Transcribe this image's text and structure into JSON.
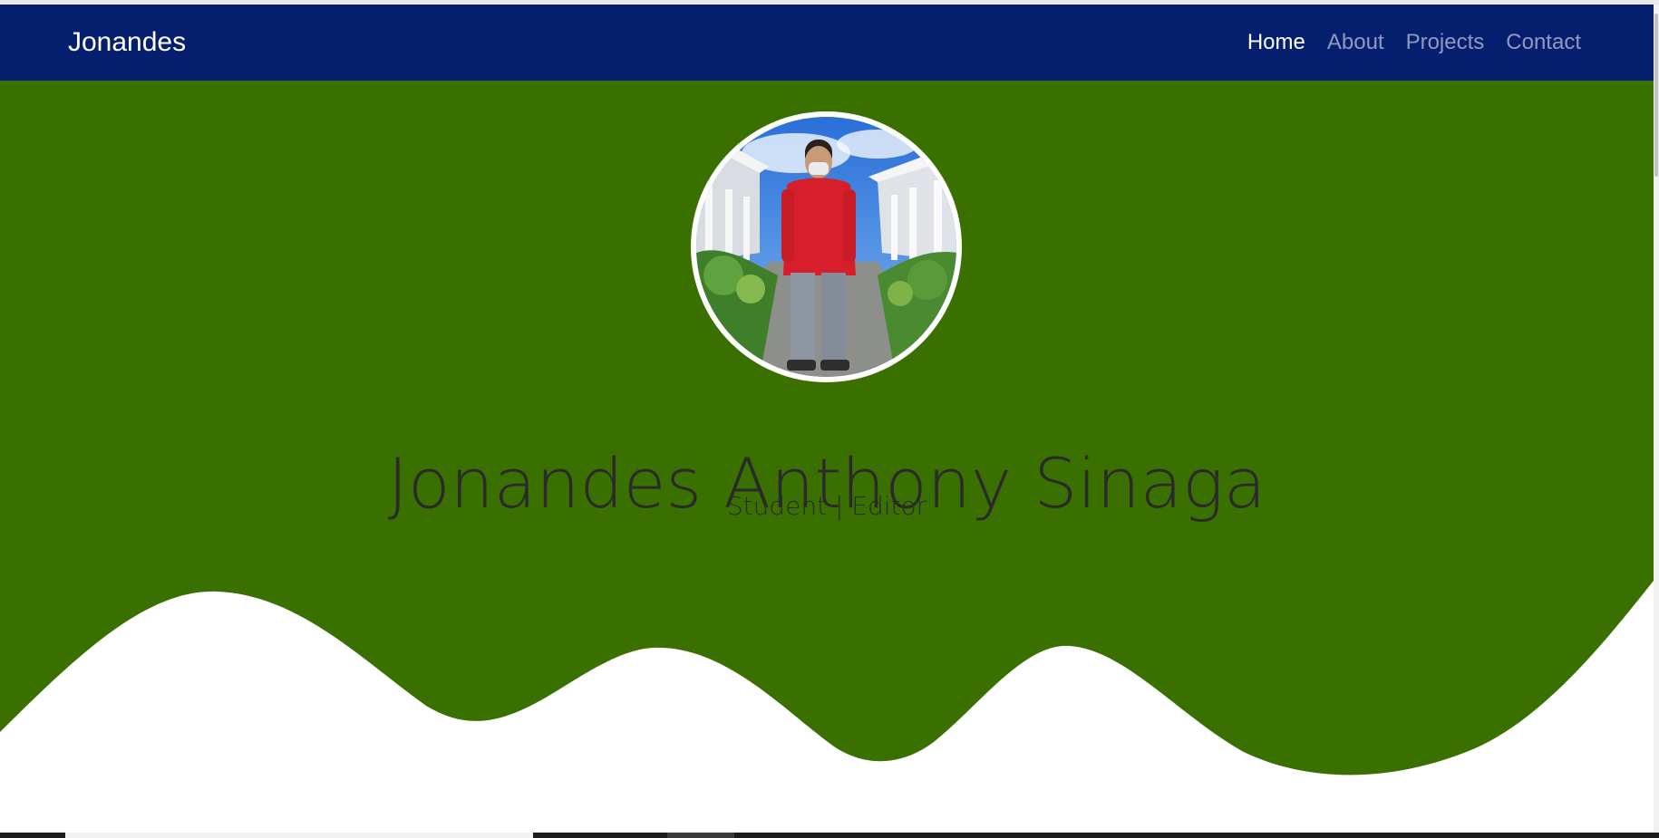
{
  "navbar": {
    "brand": "Jonandes",
    "links": [
      {
        "label": "Home",
        "active": true
      },
      {
        "label": "About",
        "active": false
      },
      {
        "label": "Projects",
        "active": false
      },
      {
        "label": "Contact",
        "active": false
      }
    ],
    "background_color": "#061e6e"
  },
  "hero": {
    "name": "Jonandes Anthony Sinaga",
    "subtitle": "Student | Editor",
    "background_color": "#3a7000",
    "wave_color": "#ffffff"
  },
  "icons": {
    "avatar": "profile-photo"
  }
}
